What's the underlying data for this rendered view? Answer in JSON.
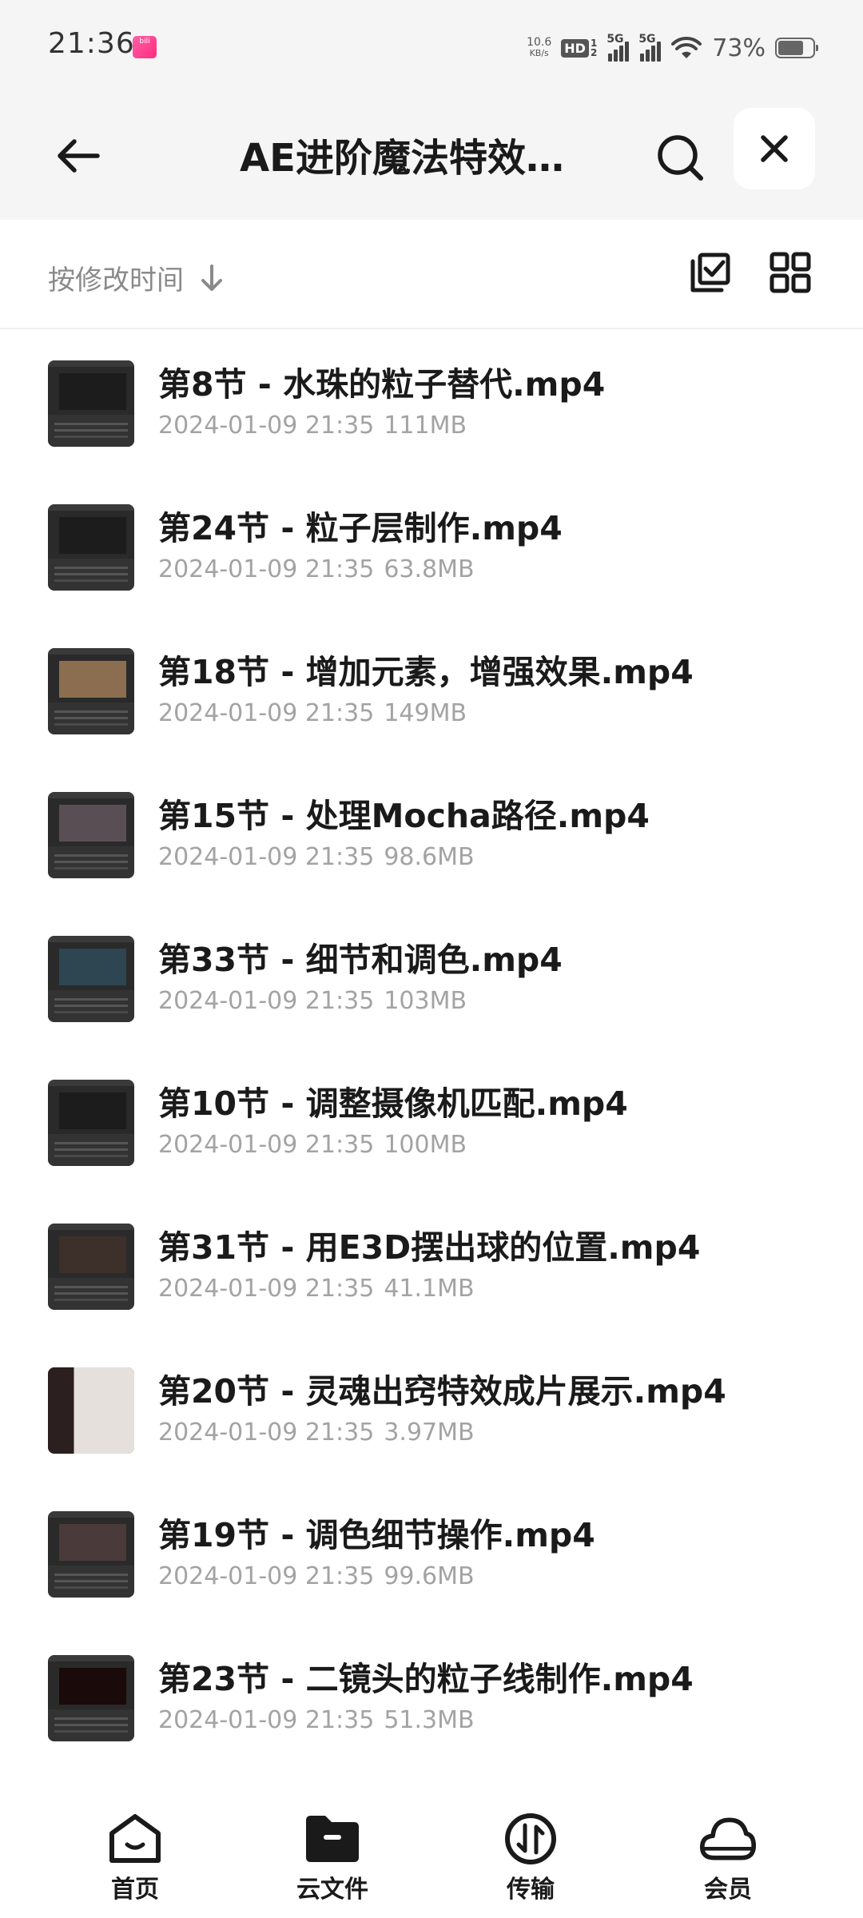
{
  "status_bar": {
    "time": "21:36",
    "net_speed_value": "10.6",
    "net_speed_unit": "KB/s",
    "hd_label": "HD",
    "hd_sub_top": "1",
    "hd_sub_bottom": "2",
    "sim1_label": "5G",
    "sim2_label": "5G",
    "battery_percent": "73%",
    "battery_level": 0.73
  },
  "header": {
    "title": "AE进阶魔法特效案…"
  },
  "sort_bar": {
    "label": "按修改时间"
  },
  "files": [
    {
      "name": "第8节 - 水珠的粒子替代.mp4",
      "date": "2024-01-09 21:35",
      "size": "111MB",
      "thumb": "editor"
    },
    {
      "name": "第24节 - 粒子层制作.mp4",
      "date": "2024-01-09 21:35",
      "size": "63.8MB",
      "thumb": "editor"
    },
    {
      "name": "第18节 - 增加元素，增强效果.mp4",
      "date": "2024-01-09 21:35",
      "size": "149MB",
      "thumb": "editor"
    },
    {
      "name": "第15节 - 处理Mocha路径.mp4",
      "date": "2024-01-09 21:35",
      "size": "98.6MB",
      "thumb": "editor"
    },
    {
      "name": "第33节 - 细节和调色.mp4",
      "date": "2024-01-09 21:35",
      "size": "103MB",
      "thumb": "editor"
    },
    {
      "name": "第10节 - 调整摄像机匹配.mp4",
      "date": "2024-01-09 21:35",
      "size": "100MB",
      "thumb": "editor"
    },
    {
      "name": "第31节 - 用E3D摆出球的位置.mp4",
      "date": "2024-01-09 21:35",
      "size": "41.1MB",
      "thumb": "editor"
    },
    {
      "name": "第20节 - 灵魂出窍特效成片展示.mp4",
      "date": "2024-01-09 21:35",
      "size": "3.97MB",
      "thumb": "photo"
    },
    {
      "name": "第19节 - 调色细节操作.mp4",
      "date": "2024-01-09 21:35",
      "size": "99.6MB",
      "thumb": "editor"
    },
    {
      "name": "第23节 - 二镜头的粒子线制作.mp4",
      "date": "2024-01-09 21:35",
      "size": "51.3MB",
      "thumb": "editor"
    }
  ],
  "bottom_nav": {
    "items": [
      {
        "label": "首页",
        "icon": "home-icon"
      },
      {
        "label": "云文件",
        "icon": "folder-icon"
      },
      {
        "label": "传输",
        "icon": "transfer-icon"
      },
      {
        "label": "会员",
        "icon": "cloud-icon"
      }
    ]
  },
  "colors": {
    "header_bg": "#f5f5f5",
    "text_primary": "#1a1a1a",
    "text_secondary": "#a3a3a3",
    "sort_label": "#8a8a8a"
  }
}
